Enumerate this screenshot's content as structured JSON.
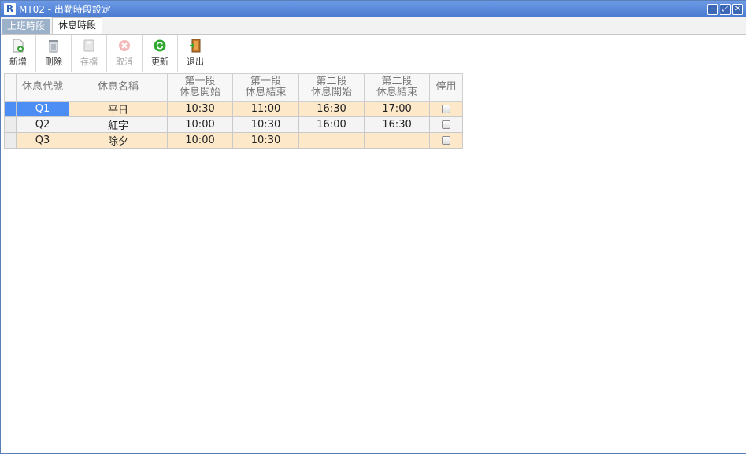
{
  "window": {
    "app_letter": "R",
    "title": "MT02 - 出勤時段設定"
  },
  "tabs": [
    {
      "label": "上班時段"
    },
    {
      "label": "休息時段"
    }
  ],
  "toolbar": {
    "new_label": "新增",
    "delete_label": "刪除",
    "save_label": "存檔",
    "cancel_label": "取消",
    "refresh_label": "更新",
    "exit_label": "退出"
  },
  "grid": {
    "headers": {
      "code": "休息代號",
      "name": "休息名稱",
      "b1_start_l1": "第一段",
      "b1_start_l2": "休息開始",
      "b1_end_l1": "第一段",
      "b1_end_l2": "休息結束",
      "b2_start_l1": "第二段",
      "b2_start_l2": "休息開始",
      "b2_end_l1": "第二段",
      "b2_end_l2": "休息結束",
      "disabled": "停用"
    },
    "rows": [
      {
        "code": "Q1",
        "name": "平日",
        "b1_start": "10:30",
        "b1_end": "11:00",
        "b2_start": "16:30",
        "b2_end": "17:00"
      },
      {
        "code": "Q2",
        "name": "紅字",
        "b1_start": "10:00",
        "b1_end": "10:30",
        "b2_start": "16:00",
        "b2_end": "16:30"
      },
      {
        "code": "Q3",
        "name": "除夕",
        "b1_start": "10:00",
        "b1_end": "10:30",
        "b2_start": "",
        "b2_end": ""
      }
    ]
  },
  "colors": {
    "titlebar": "#5b8ae0",
    "selection": "#4d8ef5",
    "row_highlight": "#fde9c9"
  }
}
